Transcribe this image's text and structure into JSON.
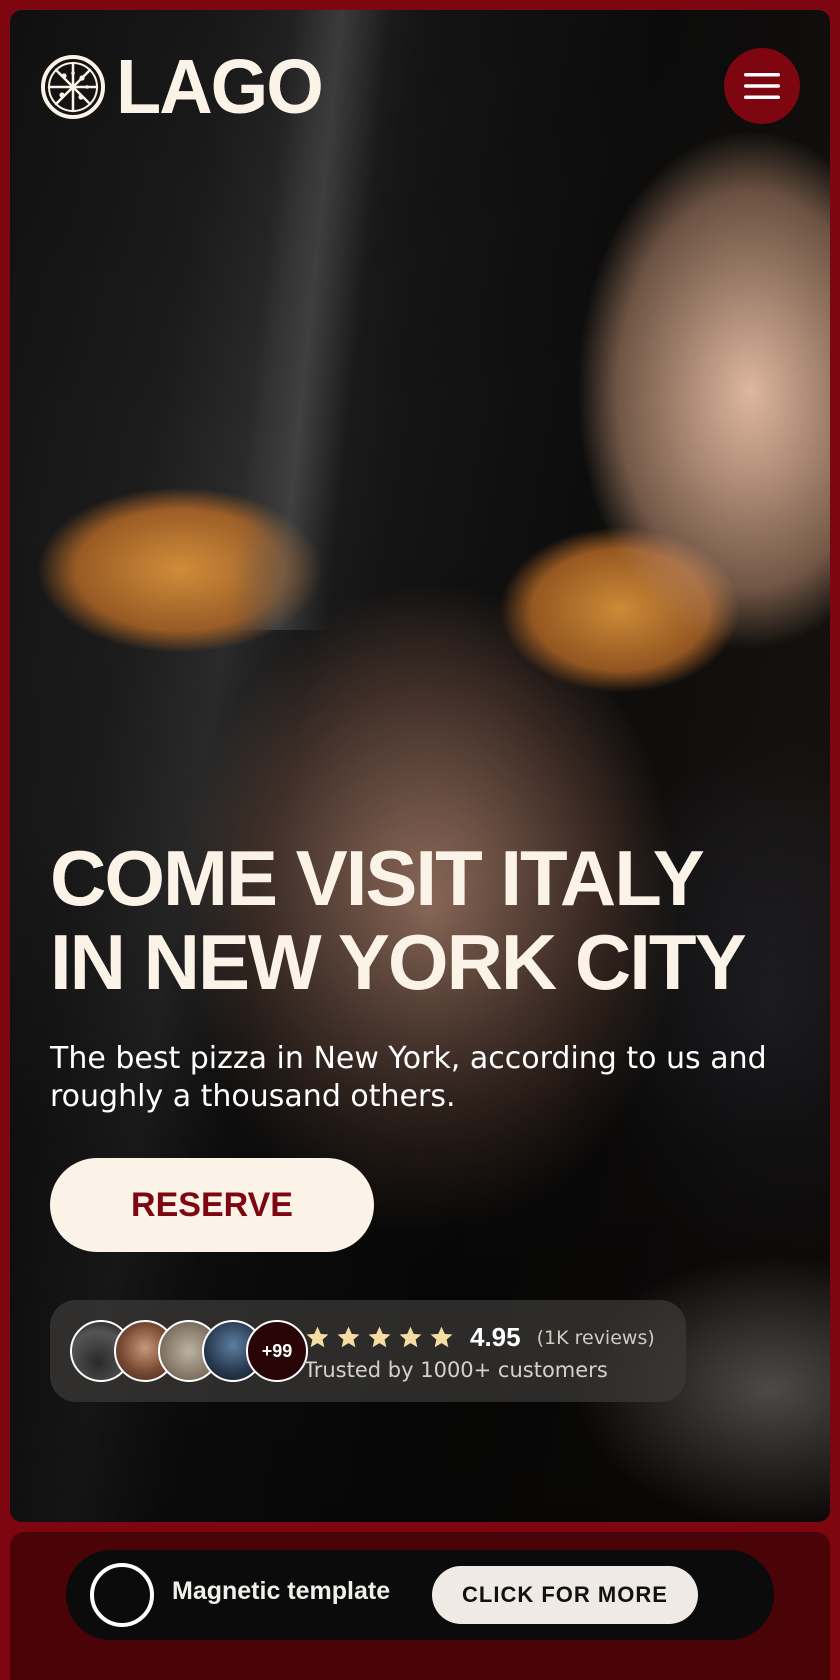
{
  "brand": {
    "name": "LAGO",
    "logo_icon": "pizza-icon"
  },
  "header": {
    "menu_icon": "hamburger-icon"
  },
  "hero": {
    "headline_line1": "COME VISIT ITALY",
    "headline_line2": "IN NEW YORK CITY",
    "subtitle": "The best pizza in New York, according to us and roughly a thousand others.",
    "cta_label": "RESERVE"
  },
  "social_proof": {
    "avatars": [
      "avatar-1",
      "avatar-2",
      "avatar-3",
      "avatar-4"
    ],
    "more_count": "+99",
    "stars": 5,
    "rating": "4.95",
    "review_count": "(1K reviews)",
    "trusted_text": "Trusted by 1000+ customers"
  },
  "template_bar": {
    "label": "Magnetic template",
    "button_label": "CLICK FOR MORE"
  },
  "colors": {
    "brand_red": "#7d0610",
    "cream": "#fbf3e8",
    "star_gold": "#f5dca2",
    "dark_panel": "#4a0307"
  }
}
